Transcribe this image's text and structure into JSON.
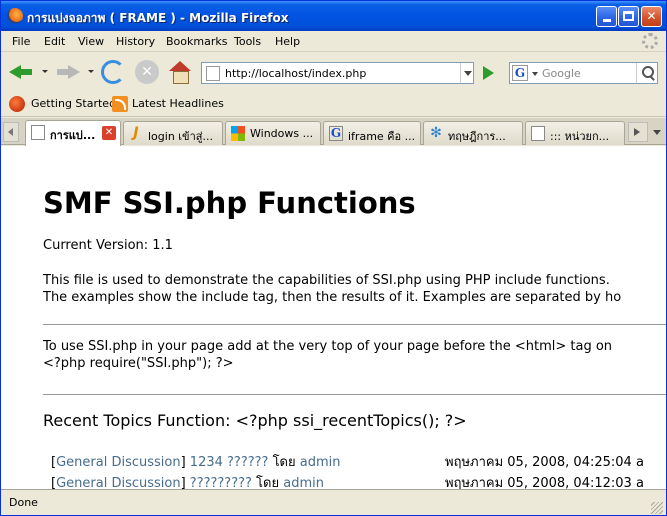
{
  "window": {
    "title": "การแบ่งจอภาพ ( FRAME ) - Mozilla Firefox"
  },
  "menu": {
    "items": [
      "File",
      "Edit",
      "View",
      "History",
      "Bookmarks",
      "Tools",
      "Help"
    ]
  },
  "nav": {
    "url": "http://localhost/index.php",
    "search_placeholder": "Google",
    "search_engine_letter": "G"
  },
  "bookmarks": {
    "items": [
      "Getting Started",
      "Latest Headlines"
    ]
  },
  "tabs": [
    {
      "label": "การแบ่...",
      "icon": "page-icon",
      "active": true
    },
    {
      "label": "login เข้าสู่...",
      "icon": "joomla-icon"
    },
    {
      "label": "Windows ...",
      "icon": "windows-icon"
    },
    {
      "label": "iframe คือ ...",
      "icon": "google-icon"
    },
    {
      "label": "ทฤษฎีการ...",
      "icon": "snowflake-icon"
    },
    {
      "label": "::: หน่วยก...",
      "icon": "page-icon"
    }
  ],
  "page": {
    "title": "SMF SSI.php Functions",
    "version": "Current Version: 1.1",
    "intro_line1": "This file is used to demonstrate the capabilities of SSI.php using PHP include functions.",
    "intro_line2": "The examples show the include tag, then the results of it. Examples are separated by ho",
    "usage_line1": "To use SSI.php in your page add at the very top of your page before the <html> tag on",
    "usage_line2": "<?php require(\"SSI.php\"); ?>",
    "section_title": "Recent Topics Function: <?php ssi_recentTopics(); ?>",
    "topics": [
      {
        "board": "General Discussion",
        "subject": "1234 ??????",
        "by": "โดย",
        "author": "admin",
        "date": "พฤษภาคม 05, 2008, 04:25:04 a"
      },
      {
        "board": "General Discussion",
        "subject": "?????????",
        "by": "โดย",
        "author": "admin",
        "date": "พฤษภาคม 05, 2008, 04:12:03 a"
      }
    ]
  },
  "status": {
    "text": "Done"
  },
  "colors": {
    "titlebar": "#0053e1",
    "link": "#476c8e",
    "chrome": "#ece9d8"
  }
}
